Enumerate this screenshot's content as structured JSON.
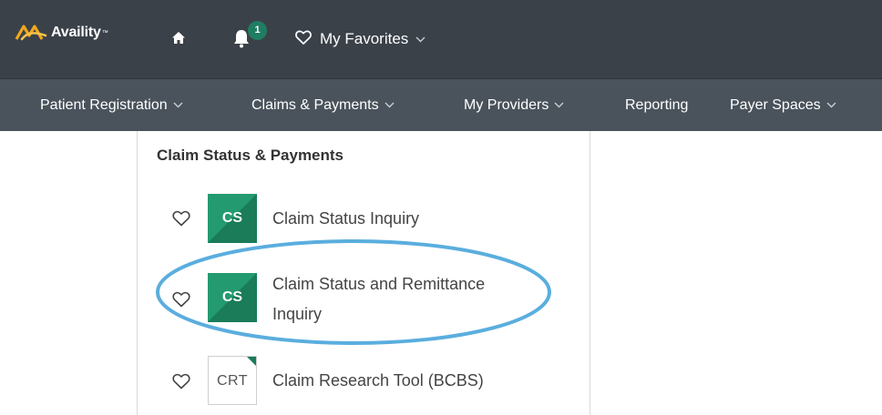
{
  "brand": {
    "logo_text": "Availity",
    "logo_mark": "™",
    "logo_color": "#f0a81e"
  },
  "topbar": {
    "home_icon": "home-icon",
    "bell_icon": "bell-icon",
    "notification_count": "1",
    "favorites_label": "My Favorites"
  },
  "nav": {
    "items": [
      {
        "label": "Patient Registration",
        "has_dropdown": true
      },
      {
        "label": "Claims & Payments",
        "has_dropdown": true
      },
      {
        "label": "My Providers",
        "has_dropdown": true
      },
      {
        "label": "Reporting",
        "has_dropdown": false
      },
      {
        "label": "Payer Spaces",
        "has_dropdown": true
      }
    ]
  },
  "dropdown": {
    "section_title": "Claim Status & Payments",
    "items": [
      {
        "tile": "CS",
        "label": "Claim Status Inquiry",
        "tile_style": "green"
      },
      {
        "tile": "CS",
        "label_line1": "Claim Status and Remittance",
        "label_line2": "Inquiry",
        "tile_style": "green",
        "highlighted": true
      },
      {
        "tile": "CRT",
        "label": "Claim Research Tool (BCBS)",
        "tile_style": "white"
      }
    ]
  },
  "colors": {
    "topbar_bg": "#3b4149",
    "navbar_bg": "#4a535c",
    "badge_green": "#1f7d61",
    "tile_green": "#239a70",
    "highlight_ring": "#5aaede"
  }
}
